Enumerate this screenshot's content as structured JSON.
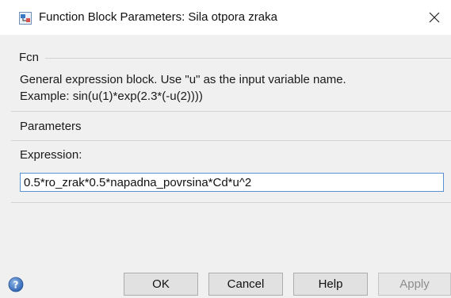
{
  "window": {
    "title": "Function Block Parameters: Sila otpora zraka",
    "close_glyph": "✕"
  },
  "block": {
    "group_label": "Fcn",
    "description_line1": "General expression block. Use \"u\" as the input variable name.",
    "description_line2": "Example: sin(u(1)*exp(2.3*(-u(2))))"
  },
  "parameters": {
    "group_label": "Parameters",
    "expression_label": "Expression:",
    "expression_value": "0.5*ro_zrak*0.5*napadna_povrsina*Cd*u^2"
  },
  "buttons": {
    "ok": "OK",
    "cancel": "Cancel",
    "help": "Help",
    "apply": "Apply"
  },
  "icons": {
    "app": "simulink-block-icon",
    "help": "help-question-icon",
    "close": "close-icon"
  },
  "colors": {
    "dialog_bg": "#f0f0f0",
    "input_border": "#5b8fd6",
    "help_icon": "#3f7cc7"
  }
}
